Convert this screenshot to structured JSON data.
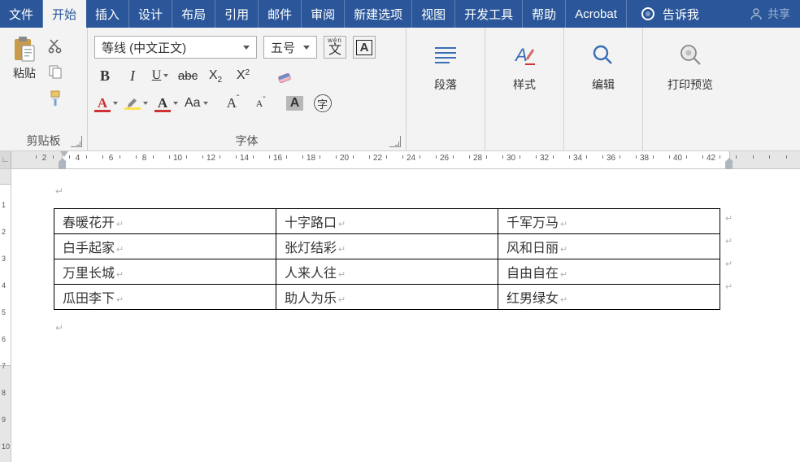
{
  "tabs": [
    "文件",
    "开始",
    "插入",
    "设计",
    "布局",
    "引用",
    "邮件",
    "审阅",
    "新建选项",
    "视图",
    "开发工具",
    "帮助",
    "Acrobat"
  ],
  "active_tab_index": 1,
  "tell_me": "告诉我",
  "share": "共享",
  "clipboard": {
    "paste": "粘贴",
    "group": "剪贴板"
  },
  "font": {
    "name": "等线 (中文正文)",
    "size": "五号",
    "ruby_top": "wén",
    "ruby_bot": "文",
    "boxed": "A",
    "group": "字体",
    "bold": "B",
    "italic": "I",
    "underline": "U",
    "strike": "abc",
    "sub_x": "X",
    "sub_2": "2",
    "sup_x": "X",
    "sup_2": "2",
    "charA": "A",
    "highlight": "ab",
    "caseAa": "Aa",
    "growA": "A",
    "growUp": "ˆ",
    "growDn": "ˇ",
    "shaded": "A",
    "circled": "字"
  },
  "groups": {
    "paragraph": "段落",
    "styles": "样式",
    "edit": "编辑",
    "print": "打印预览"
  },
  "ruler": {
    "numbers": [
      2,
      4,
      6,
      8,
      10,
      12,
      14,
      16,
      18,
      20,
      22,
      24,
      26,
      28,
      30,
      32,
      34,
      36,
      38,
      40,
      42
    ]
  },
  "vruler": {
    "numbers": [
      1,
      2,
      3,
      4,
      5,
      6,
      7,
      8,
      9,
      10
    ]
  },
  "table": {
    "rows": [
      [
        "春暖花开",
        "十字路口",
        "千军万马"
      ],
      [
        "白手起家",
        "张灯结彩",
        "风和日丽"
      ],
      [
        "万里长城",
        "人来人往",
        "自由自在"
      ],
      [
        "瓜田李下",
        "助人为乐",
        "红男绿女"
      ]
    ]
  }
}
